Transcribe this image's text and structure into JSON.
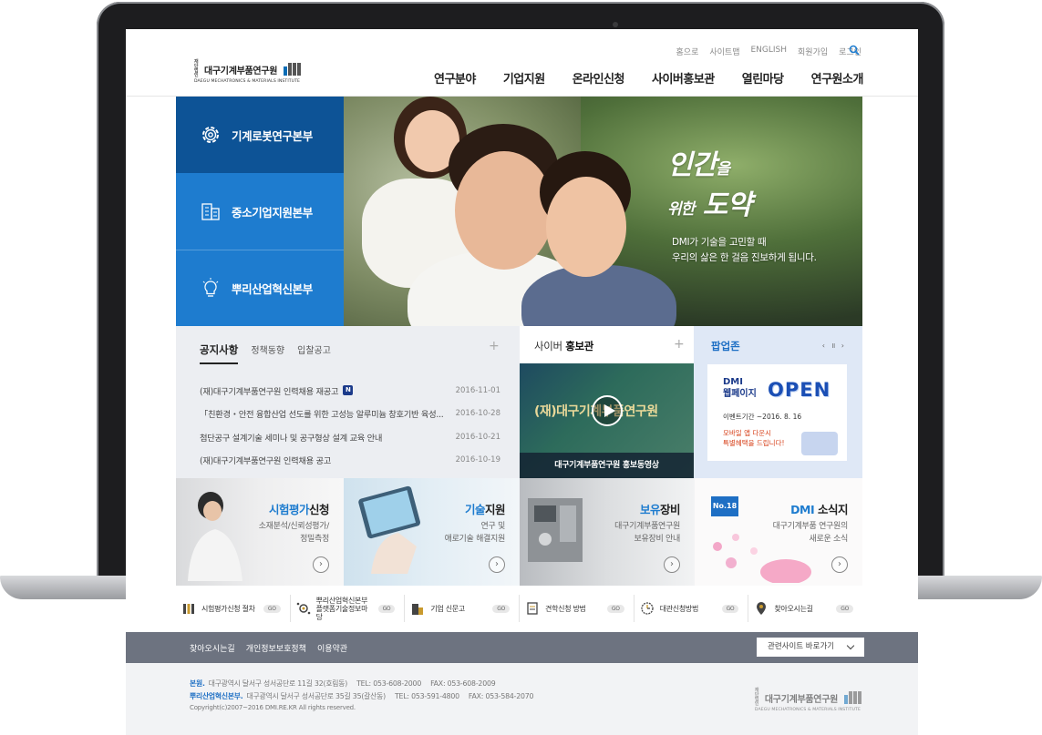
{
  "header": {
    "logo": {
      "foundation": "재단법인",
      "name": "대구기계부품연구원",
      "english": "DAEGU MECHATRONICS & MATERIALS INSTITUTE"
    },
    "util_links": [
      "홈으로",
      "사이트맵",
      "ENGLISH",
      "회원가입",
      "로그인"
    ],
    "gnb": [
      "연구분야",
      "기업지원",
      "온라인신청",
      "사이버홍보관",
      "열린마당",
      "연구원소개"
    ]
  },
  "side_menu": [
    "기계로봇연구본부",
    "중소기업지원본부",
    "뿌리산업혁신본부"
  ],
  "hero": {
    "title_big1": "인간",
    "title_small1": "을",
    "title_small2": "위한",
    "title_big2": "도약",
    "copy_line1": "DMI가 기술을 고민할 때",
    "copy_line2": "우리의 삶은 한 걸음 진보하게 됩니다."
  },
  "notice": {
    "tabs": [
      "공지사항",
      "정책동향",
      "입찰공고"
    ],
    "items": [
      {
        "title": "(재)대구기계부품연구원 인력채용 재공고",
        "date": "2016-11-01",
        "badge": "N"
      },
      {
        "title": "「친환경・안전 융합산업 선도를 위한 고성능 알루미늄 창호기반 육성...",
        "date": "2016-10-28"
      },
      {
        "title": "첨단공구 설계기술 세미나 및 공구형상 설계 교육 안내",
        "date": "2016-10-21"
      },
      {
        "title": "(재)대구기계부품연구원 인력채용 공고",
        "date": "2016-10-19"
      }
    ]
  },
  "promo": {
    "title_prefix": "사이버",
    "title_bold": "홍보관",
    "video_overlay": "(재)대구기계부품연구원",
    "video_caption": "대구기계부품연구원 홍보동영상"
  },
  "popup": {
    "title": "팝업존",
    "controls": "‹ ॥ ›",
    "dmi_line1": "DMI",
    "dmi_line2": "웹페이지",
    "open": "OPEN",
    "date": "이벤트기간 ~2016. 8. 16",
    "note1": "모바일 앱 다운시",
    "note2": "특별혜택을 드립니다!"
  },
  "banners": [
    {
      "title_hl": "시험평가",
      "title_rest": "신청",
      "desc1": "소재분석/신뢰성평가/",
      "desc2": "정밀측정"
    },
    {
      "title_hl": "기술",
      "title_rest": "지원",
      "desc1": "연구 및",
      "desc2": "애로기술 해결지원"
    },
    {
      "title_hl": "보유",
      "title_rest": "장비",
      "desc1": "대구기계부품연구원",
      "desc2": "보유장비 안내"
    },
    {
      "title_hl": "DMI",
      "title_rest": " 소식지",
      "desc1": "대구기계부품 연구원의",
      "desc2": "새로운 소식",
      "badge": "No.18"
    }
  ],
  "quick_links": [
    {
      "label": "시험평가신청 절차",
      "go": "GO",
      "icon": "test-tubes-icon"
    },
    {
      "label": "뿌리산업혁신본부\n플랫폼기술정보마당",
      "go": "GO",
      "icon": "gear-network-icon"
    },
    {
      "label": "기업 신문고",
      "go": "GO",
      "icon": "building-icon"
    },
    {
      "label": "견학신청 방법",
      "go": "GO",
      "icon": "document-icon"
    },
    {
      "label": "대관신청방법",
      "go": "GO",
      "icon": "clock-icon"
    },
    {
      "label": "찾아오시는길",
      "go": "GO",
      "icon": "location-pin-icon"
    }
  ],
  "footer": {
    "links": [
      "찾아오시는길",
      "개인정보보호정책",
      "이용약관"
    ],
    "related_sites": "관련사이트 바로가기",
    "hq_label": "본원.",
    "hq_address": "대구광역시 달서구 성서공단로 11길 32(호림동)",
    "hq_tel": "TEL: 053-608-2000",
    "hq_fax": "FAX: 053-608-2009",
    "branch_label": "뿌리산업혁신본부.",
    "branch_address": "대구광역시 달서구 성서공단로 35길 35(갈산동)",
    "branch_tel": "TEL: 053-591-4800",
    "branch_fax": "FAX: 053-584-2070",
    "copyright": "Copyright(c)2007~2016 DMI.RE.KR All rights reserved."
  },
  "colors": {
    "primary_dark": "#0d5396",
    "primary": "#1e7ccf",
    "footer_bar": "#6d7380"
  }
}
